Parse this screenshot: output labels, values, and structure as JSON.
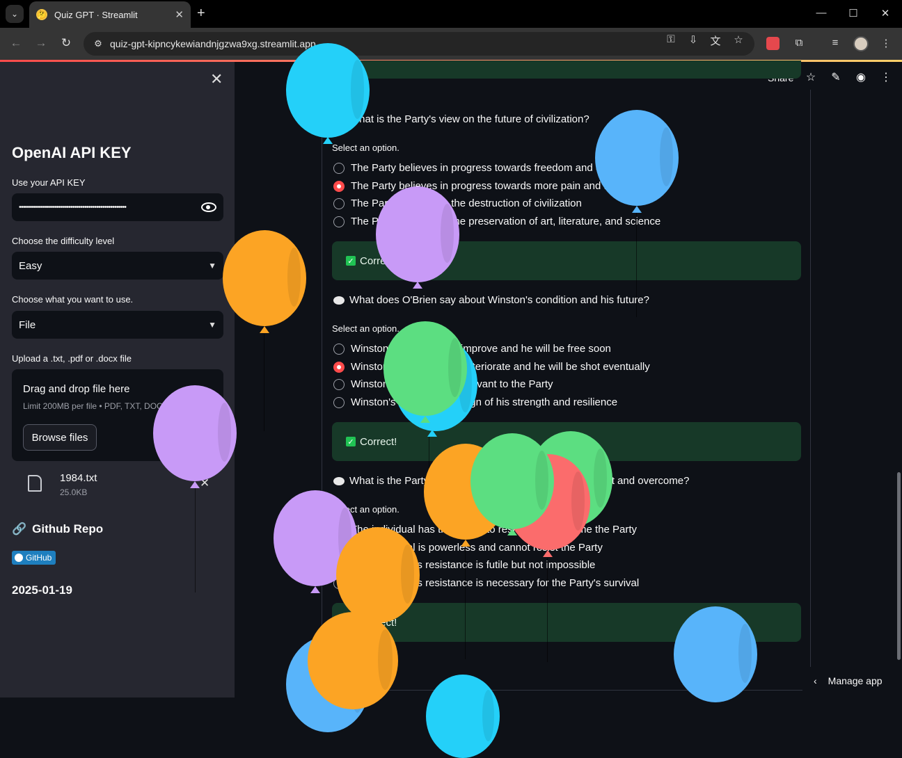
{
  "browser": {
    "tab_title": "Quiz GPT · Streamlit",
    "tab_favicon": "🤔",
    "url": "quiz-gpt-kipncykewiandnjgzwa9xg.streamlit.app"
  },
  "sidebar": {
    "heading": "OpenAI API KEY",
    "api_label": "Use your API KEY",
    "api_value": "••••••••••••••••••••••••••••••••••••••••••••••••••••••",
    "difficulty_label": "Choose the difficulty level",
    "difficulty_value": "Easy",
    "source_label": "Choose what you want to use.",
    "source_value": "File",
    "upload_label": "Upload a .txt, .pdf or .docx file",
    "dropzone_title": "Drag and drop file here",
    "dropzone_limit": "Limit 200MB per file • PDF, TXT, DOCX",
    "browse_label": "Browse files",
    "file_name": "1984.txt",
    "file_size": "25.0KB",
    "repo_heading": "Github Repo",
    "badge_label": "GitHub",
    "date": "2025-01-19"
  },
  "header": {
    "share_label": "Share"
  },
  "quiz": {
    "top_banner": "",
    "q1": {
      "question": "What is the Party's view on the future of civilization?",
      "select_label": "Select an option.",
      "options": [
        "The Party believes in progress towards freedom and equality",
        "The Party believes in progress towards more pain and fear",
        "The Party believes in the destruction of civilization",
        "The Party believes in the preservation of art, literature, and science"
      ],
      "result": "Correct!"
    },
    "q2": {
      "question": "What does O'Brien say about Winston's condition and his future?",
      "select_label": "Select an option.",
      "options": [
        "Winston's condition will improve and he will be free soon",
        "Winston's condition will deteriorate and he will be shot eventually",
        "Winston's condition is irrelevant to the Party",
        "Winston's condition is a sign of his strength and resilience"
      ],
      "result": "Correct!"
    },
    "q3": {
      "question": "What is the Party's view on the individual's ability to resist and overcome?",
      "select_label": "Select an option.",
      "options": [
        "The individual has the power to resist and overcome the Party",
        "The individual is powerless and cannot resist the Party",
        "The individual's resistance is futile but not impossible",
        "The individual's resistance is necessary for the Party's survival"
      ],
      "result": "Correct!"
    }
  },
  "footer": {
    "manage_label": "Manage app"
  },
  "colors": {
    "accent": "#ff4b4b",
    "success_bg": "#173928",
    "balloon_blue": "#58b4fa",
    "balloon_cyan": "#24d0f9",
    "balloon_purple": "#c89af7",
    "balloon_orange": "#fca424",
    "balloon_green": "#5cde81",
    "balloon_red": "#fb6c6c"
  }
}
